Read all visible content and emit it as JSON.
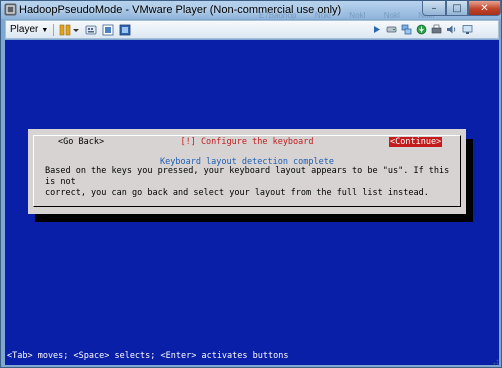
{
  "window": {
    "title": "HadoopPseudoMode - VMware Player (Non-commercial use only)",
    "ghost_tabs": [
      "E7Baonop",
      "Nokl",
      "Nokl",
      "Nokl",
      "Nokl"
    ],
    "close_glyph": "✕",
    "minimize_glyph": "–",
    "maximize_glyph": "□"
  },
  "toolbar": {
    "player_label": "Player",
    "player_dropdown": "▼"
  },
  "dialog": {
    "title": "[!] Configure the keyboard",
    "heading": "Keyboard layout detection complete",
    "body_line1": "Based on the keys you pressed, your keyboard layout appears to be \"us\". If this is not",
    "body_line2": "correct, you can go back and select your layout from the full list instead.",
    "go_back_label": "<Go Back>",
    "continue_label": "<Continue>"
  },
  "status_line": "<Tab> moves; <Space> selects; <Enter> activates buttons",
  "colors": {
    "vm_background": "#0a1fa8",
    "dialog_background": "#d7d3d3",
    "title_red": "#c21d1d",
    "heading_blue": "#1d5fb5",
    "selected_button": "#c41c1c"
  },
  "icons": {
    "app": "vmware-icon",
    "pause": "pause-icon",
    "send_ctrl_alt_del": "send-keys-icon",
    "fullscreen": "fullscreen-icon",
    "unity": "unity-icon",
    "devices": [
      "arrow-right-icon",
      "hdd-icon",
      "network-icon",
      "usb-icon",
      "printer-icon",
      "sound-icon",
      "display-icon"
    ]
  }
}
